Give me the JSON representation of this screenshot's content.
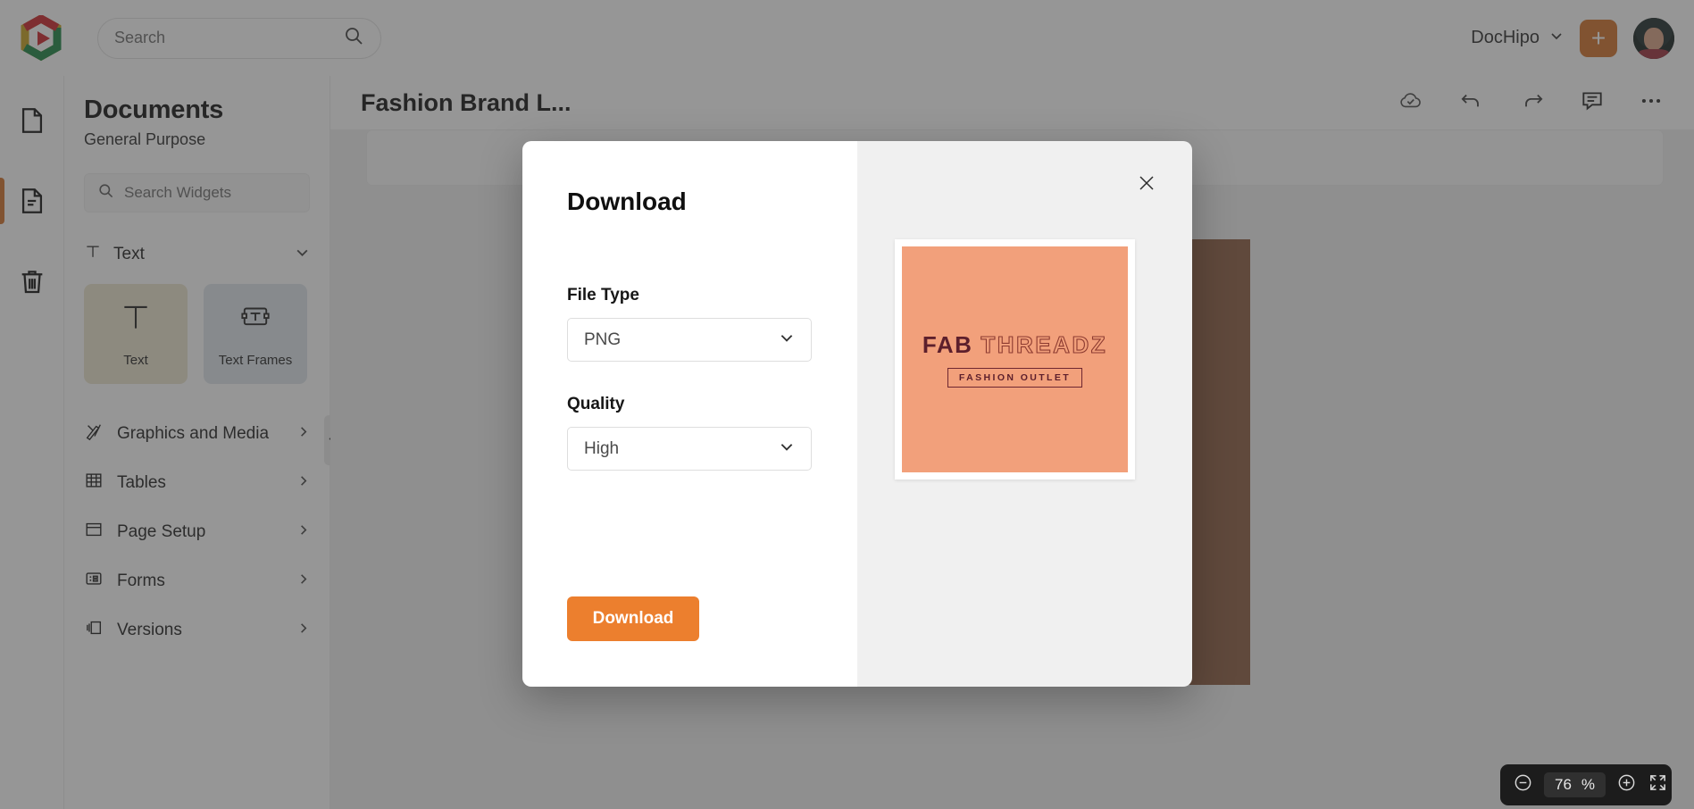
{
  "topbar": {
    "logo_icon": "dochipo-logo-icon",
    "search_placeholder": "Search",
    "search_value": "",
    "search_icon": "search-icon",
    "brand_label": "DocHipo",
    "brand_chevron_icon": "chevron-down-icon",
    "create_button_label": "+",
    "create_button_color": "#D2712A",
    "avatar_icon": "user-avatar"
  },
  "rail": {
    "items": [
      {
        "name": "blank-page",
        "icon": "page-icon",
        "active": false
      },
      {
        "name": "documents",
        "icon": "document-lines-icon",
        "active": true
      },
      {
        "name": "trash",
        "icon": "trash-icon",
        "active": false
      }
    ],
    "active_indicator_color": "#D2712A"
  },
  "panel": {
    "title": "Documents",
    "subtitle": "General Purpose",
    "search_placeholder": "Search Widgets",
    "search_value": "",
    "search_icon": "search-icon",
    "section": {
      "label": "Text",
      "icon": "text-t-icon",
      "chevron_icon": "chevron-down-icon"
    },
    "tiles": [
      {
        "label": "Text",
        "icon": "text-t-icon",
        "bg": "#ECE5CF"
      },
      {
        "label": "Text Frames",
        "icon": "text-frame-icon",
        "bg": "#DFE6EC"
      }
    ],
    "menu": [
      {
        "label": "Graphics and Media",
        "icon": "graphics-media-icon",
        "arrow": "chevron-right-icon"
      },
      {
        "label": "Tables",
        "icon": "table-grid-icon",
        "arrow": "chevron-right-icon"
      },
      {
        "label": "Page Setup",
        "icon": "page-setup-icon",
        "arrow": "chevron-right-icon"
      },
      {
        "label": "Forms",
        "icon": "forms-icon",
        "arrow": "chevron-right-icon"
      },
      {
        "label": "Versions",
        "icon": "versions-icon",
        "arrow": "chevron-right-icon"
      }
    ],
    "collapse_icon": "chevron-left-icon"
  },
  "canvas": {
    "doc_title": "Fashion Brand L...",
    "tools": [
      {
        "name": "cloud-saved",
        "icon": "cloud-check-icon"
      },
      {
        "name": "undo",
        "icon": "undo-arrow-icon"
      },
      {
        "name": "redo",
        "icon": "redo-arrow-icon"
      },
      {
        "name": "comments",
        "icon": "comment-bubble-icon"
      },
      {
        "name": "more-options",
        "icon": "more-horizontal-icon"
      }
    ],
    "page_bg": "#8D5B41",
    "page_wordmark": "FAB THREADZ",
    "page_ink": "#52202A"
  },
  "zoom_control": {
    "zoom_out_icon": "minus-circle-icon",
    "value": "76",
    "unit": "%",
    "zoom_in_icon": "plus-circle-icon",
    "fullscreen_icon": "expand-icon"
  },
  "modal": {
    "title": "Download",
    "close_icon": "close-icon",
    "fields": [
      {
        "label": "File Type",
        "value": "PNG",
        "chevron_icon": "chevron-down-icon"
      },
      {
        "label": "Quality",
        "value": "High",
        "chevron_icon": "chevron-down-icon"
      }
    ],
    "submit_label": "Download",
    "submit_color": "#EC7F2E",
    "preview": {
      "bg": "#F2A07B",
      "word_solid": "FAB",
      "word_outline": "THREADZ",
      "tagline": "FASHION OUTLET",
      "ink": "#5D1F2C"
    }
  }
}
